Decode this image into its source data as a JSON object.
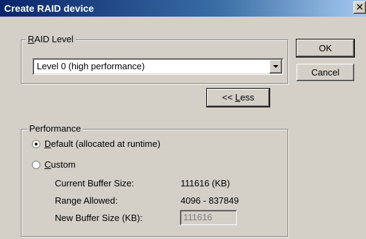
{
  "window": {
    "title": "Create RAID device",
    "close_label": "✕"
  },
  "raid_level": {
    "group_label_accel": "R",
    "group_label_rest": "AID Level",
    "selected": "Level 0 (high performance)"
  },
  "buttons": {
    "ok": "OK",
    "cancel": "Cancel",
    "less_prefix": "<< ",
    "less_accel": "L",
    "less_rest": "ess"
  },
  "performance": {
    "group_label": "Performance",
    "option_default_accel": "D",
    "option_default_rest": "efault (allocated at runtime)",
    "option_custom_accel": "C",
    "option_custom_rest": "ustom",
    "selected": "default",
    "current_buffer_label": "Current Buffer Size:",
    "current_buffer_value": "111616 (KB)",
    "range_label": "Range Allowed:",
    "range_value": "4096 - 837849",
    "new_buffer_label": "New Buffer Size (KB):",
    "new_buffer_value": "111616"
  }
}
